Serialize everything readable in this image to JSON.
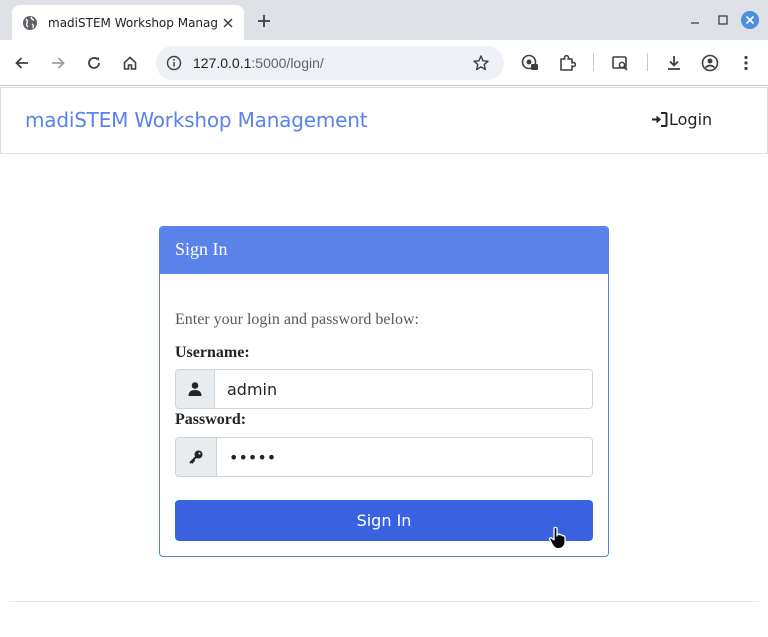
{
  "browser": {
    "tab_title": "madiSTEM Workshop Manag",
    "url_host": "127.0.0.1",
    "url_path": ":5000/login/"
  },
  "navbar": {
    "brand": "madiSTEM Workshop Management",
    "login_label": "Login",
    "brand_color": "#5b82e8"
  },
  "card": {
    "header": "Sign In",
    "hint": "Enter your login and password below:",
    "username_label": "Username:",
    "username_value": "admin",
    "password_label": "Password:",
    "password_value": "admin",
    "submit_label": "Sign In",
    "accent_color": "#5a82e8",
    "button_color": "#3a62e0"
  },
  "icons": {
    "user": "user-icon",
    "key": "key-icon",
    "login": "sign-in-icon"
  }
}
